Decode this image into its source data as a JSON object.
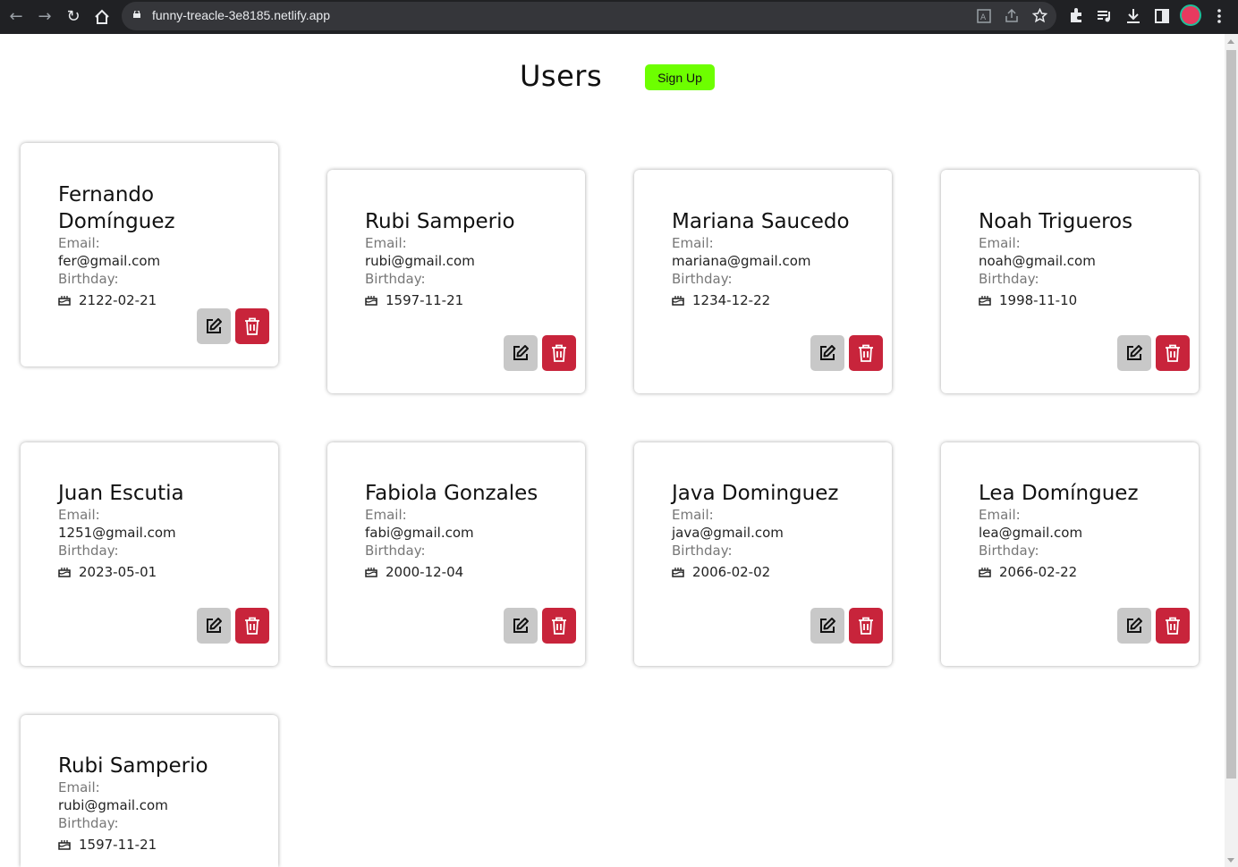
{
  "browser": {
    "url": "funny-treacle-3e8185.netlify.app"
  },
  "page": {
    "title": "Users",
    "signup_label": "Sign Up"
  },
  "labels": {
    "email": "Email:",
    "birthday": "Birthday:"
  },
  "icons": {
    "edit": "edit-icon",
    "delete": "trash-icon",
    "birthday": "cake-icon"
  },
  "colors": {
    "signup": "#6dff00",
    "delete": "#c8243b",
    "edit": "#c8c8c8"
  },
  "users": [
    {
      "name": "Fernando Domínguez",
      "email": "fer@gmail.com",
      "birthday": "2122-02-21"
    },
    {
      "name": "Rubi Samperio",
      "email": "rubi@gmail.com",
      "birthday": "1597-11-21"
    },
    {
      "name": "Mariana Saucedo",
      "email": "mariana@gmail.com",
      "birthday": "1234-12-22"
    },
    {
      "name": "Noah Trigueros",
      "email": "noah@gmail.com",
      "birthday": "1998-11-10"
    },
    {
      "name": "Juan Escutia",
      "email": "1251@gmail.com",
      "birthday": "2023-05-01"
    },
    {
      "name": "Fabiola Gonzales",
      "email": "fabi@gmail.com",
      "birthday": "2000-12-04"
    },
    {
      "name": "Java Dominguez",
      "email": "java@gmail.com",
      "birthday": "2006-02-02"
    },
    {
      "name": "Lea Domínguez",
      "email": "lea@gmail.com",
      "birthday": "2066-02-22"
    },
    {
      "name": "Rubi Samperio",
      "email": "rubi@gmail.com",
      "birthday": "1597-11-21"
    }
  ]
}
